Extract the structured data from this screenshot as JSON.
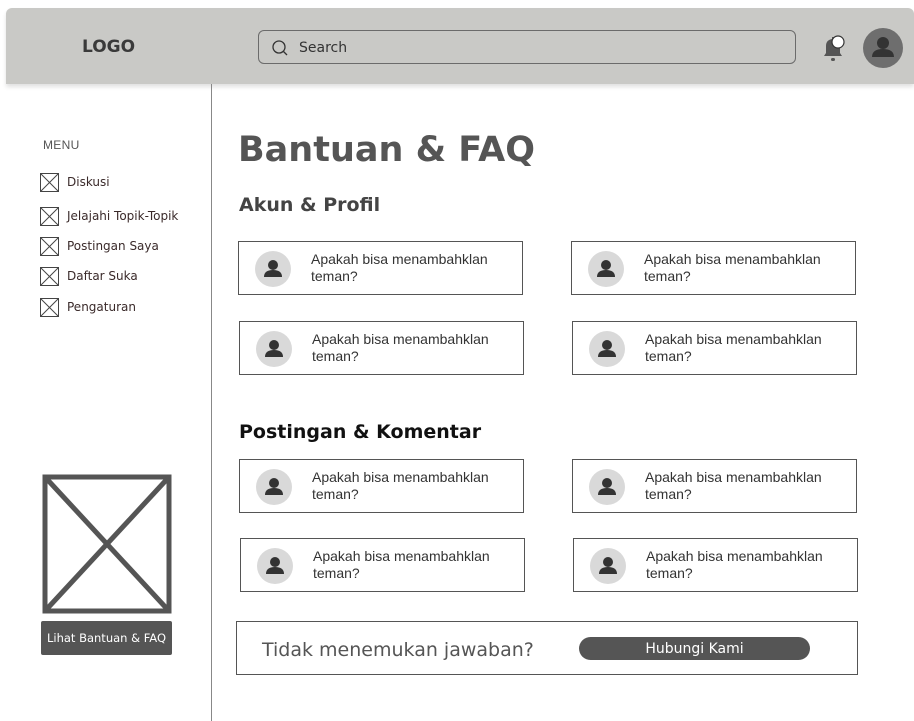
{
  "header": {
    "logo": "LOGO",
    "search_placeholder": "Search",
    "icons": [
      "search-icon",
      "bell-icon",
      "user-avatar-icon"
    ]
  },
  "sidebar": {
    "menu_title": "MENU",
    "items": [
      {
        "label": "Diskusi",
        "icon": "placeholder-x-icon"
      },
      {
        "label": "Jelajahi Topik-Topik",
        "icon": "placeholder-x-icon"
      },
      {
        "label": "Postingan Saya",
        "icon": "placeholder-x-icon"
      },
      {
        "label": "Daftar Suka",
        "icon": "placeholder-x-icon"
      },
      {
        "label": "Pengaturan",
        "icon": "placeholder-x-icon"
      }
    ],
    "help_button": "Lihat Bantuan & FAQ"
  },
  "main": {
    "title": "Bantuan & FAQ",
    "sections": [
      {
        "title": "Akun & Profil",
        "questions": [
          "Apakah bisa menambahklan teman?",
          "Apakah bisa menambahklan teman?",
          "Apakah bisa menambahklan teman?",
          "Apakah bisa menambahklan teman?"
        ]
      },
      {
        "title": "Postingan & Komentar",
        "questions": [
          "Apakah bisa menambahklan teman?",
          "Apakah bisa menambahklan teman?",
          "Apakah bisa menambahklan teman?",
          "Apakah bisa menambahklan teman?"
        ]
      }
    ],
    "footer": {
      "question": "Tidak menemukan jawaban?",
      "button": "Hubungi Kami"
    }
  },
  "colors": {
    "header_bg": "#c9c9c6",
    "dark_button": "#555555",
    "avatar_bg": "#d9d9d9"
  }
}
